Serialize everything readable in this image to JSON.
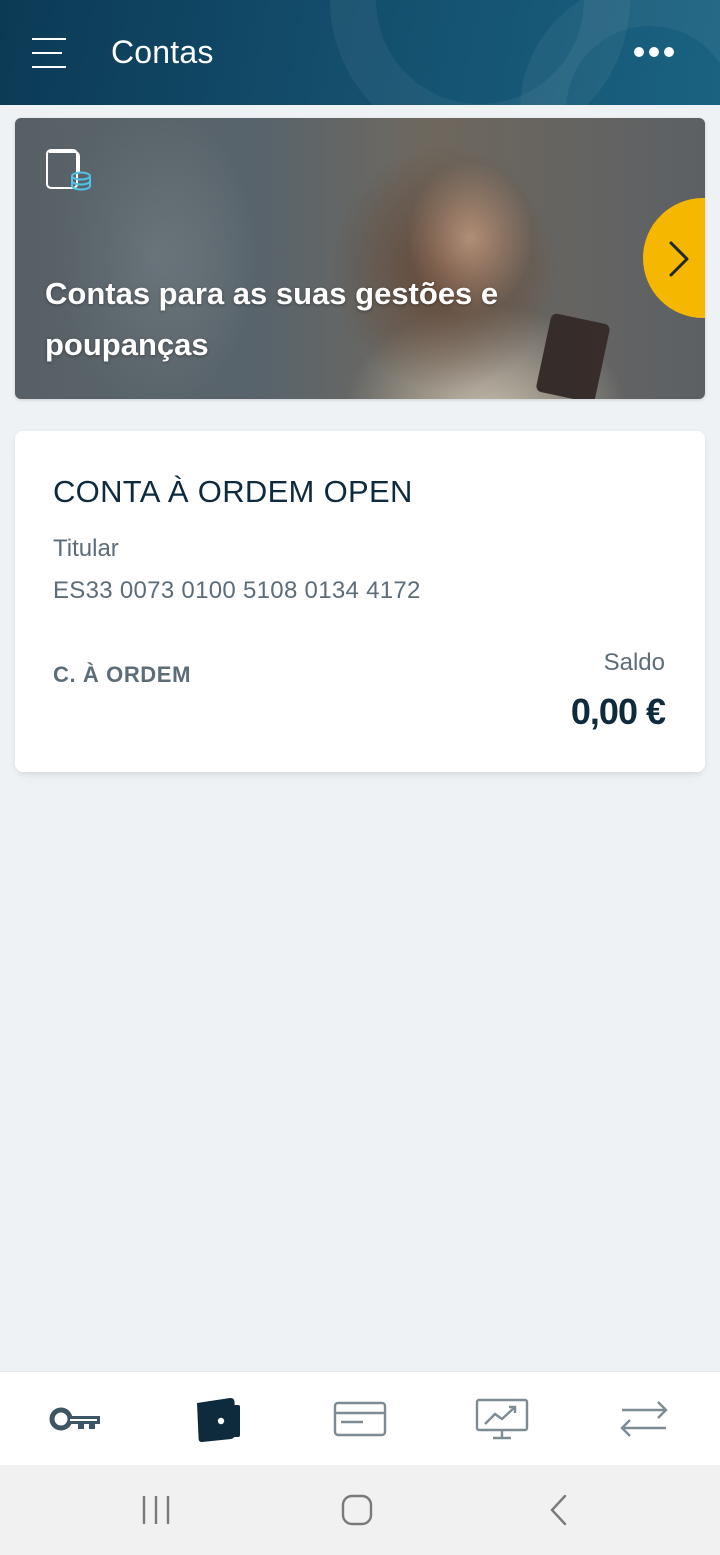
{
  "header": {
    "title": "Contas",
    "menu_icon": "hamburger-menu-icon",
    "more_icon": "more-dots-icon"
  },
  "banner": {
    "icon": "accounts-coins-icon",
    "text": "Contas para as suas gestões e poupanças",
    "next_icon": "chevron-right-icon",
    "next_button_color": "#f5b700"
  },
  "account": {
    "name": "CONTA À ORDEM OPEN",
    "holder": "Titular",
    "iban": "ES33 0073 0100 5108 0134 4172",
    "type": "C. À ORDEM",
    "balance_label": "Saldo",
    "balance": "0,00 €"
  },
  "tabbar": {
    "items": [
      {
        "icon": "key-icon",
        "active": false
      },
      {
        "icon": "wallet-icon",
        "active": true
      },
      {
        "icon": "card-icon",
        "active": false
      },
      {
        "icon": "investment-chart-icon",
        "active": false
      },
      {
        "icon": "transfer-arrows-icon",
        "active": false
      }
    ]
  },
  "system_nav": {
    "recent_icon": "recent-apps-icon",
    "home_icon": "home-icon",
    "back_icon": "back-icon"
  },
  "colors": {
    "header_bg": "#0b3a55",
    "accent": "#f5b700",
    "text_dark": "#0e2a3d",
    "text_muted": "#5d6d78",
    "page_bg": "#eef2f4"
  }
}
